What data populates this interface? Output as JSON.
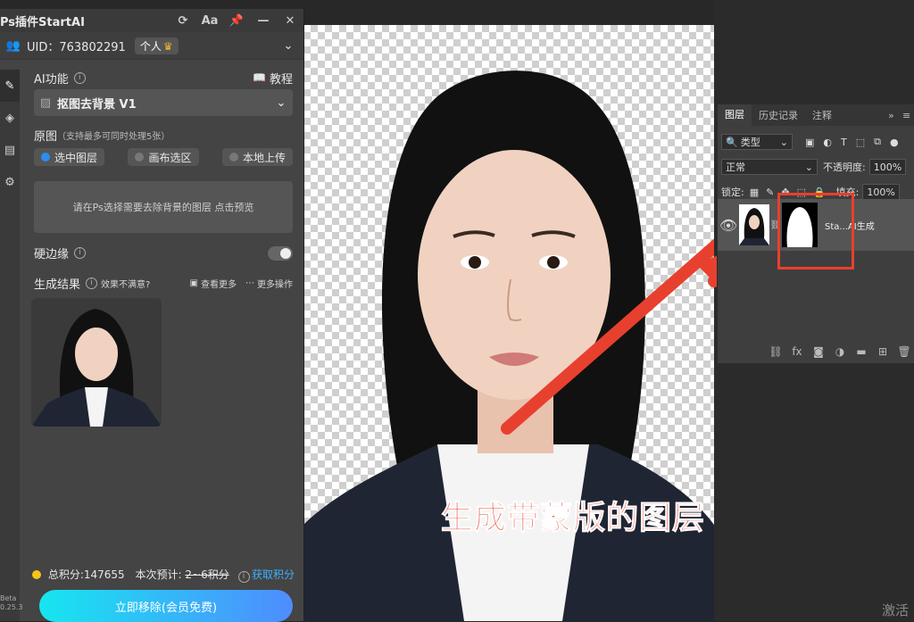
{
  "plugin": {
    "title": "Ps插件StartAI",
    "title_buttons": [
      "refresh-icon",
      "font-size-icon",
      "pin-icon",
      "minimize-icon",
      "close-icon"
    ],
    "uid_label": "UID：763802291",
    "account_badge": "个人",
    "ai_function_label": "AI功能",
    "tutorial_label": "教程",
    "selected_function": "抠图去背景 V1",
    "source_label": "原图",
    "source_hint": "（支持最多可同时处理5张）",
    "source_options": [
      {
        "label": "选中图层",
        "selected": true
      },
      {
        "label": "画布选区",
        "selected": false
      },
      {
        "label": "本地上传",
        "selected": false
      }
    ],
    "drop_hint": "请在Ps选择需要去除背景的图层 点击预览",
    "hard_edge_label": "硬边缘",
    "hard_edge_enabled": false,
    "result_label": "生成结果",
    "unsatisfied_label": "效果不满意?",
    "view_more_label": "查看更多",
    "more_actions_label": "更多操作",
    "total_points_label": "总积分:147655",
    "estimate_label": "本次预计:",
    "estimate_value": "2~6积分",
    "get_points_label": "获取积分",
    "primary_button": "立即移除(会员免费)",
    "version_lines": [
      "Beta",
      "0.25.3"
    ]
  },
  "layers_panel": {
    "tabs": [
      "图层",
      "历史记录",
      "注释"
    ],
    "active_tab": "图层",
    "filter_label": "类型",
    "blend_mode": "正常",
    "opacity_label": "不透明度:",
    "opacity_value": "100%",
    "lock_label": "锁定:",
    "fill_label": "填充:",
    "fill_value": "100%",
    "layer_name": "Sta...AI生成"
  },
  "annotation_text": "生成带蒙版的图层",
  "watermark": "激活",
  "colors": {
    "accent_red": "#e8402e",
    "accent_blue": "#2d8cf0",
    "button_gradient_start": "#17e6f0",
    "button_gradient_end": "#4f8cff",
    "points_gold": "#f5c518"
  }
}
